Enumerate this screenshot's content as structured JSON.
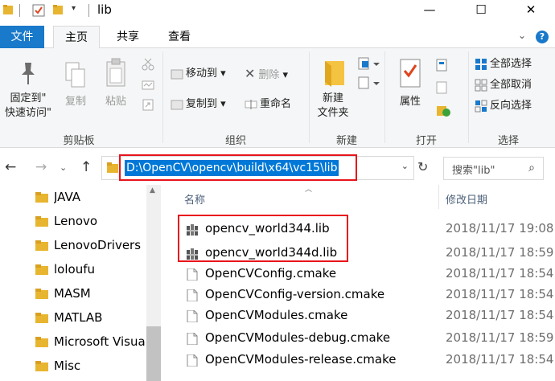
{
  "window": {
    "title": "lib",
    "minimize": "—",
    "maximize": "☐",
    "close": "✕"
  },
  "ribbon_tabs": [
    "文件",
    "主页",
    "共享",
    "查看"
  ],
  "ribbon": {
    "clipboard": {
      "pin_label_1": "固定到\"",
      "pin_label_2": "快速访问\"",
      "copy": "复制",
      "paste": "粘贴",
      "group": "剪贴板"
    },
    "organize": {
      "move_to": "移动到",
      "copy_to": "复制到",
      "delete": "删除",
      "rename": "重命名",
      "group": "组织"
    },
    "new": {
      "new_folder_1": "新建",
      "new_folder_2": "文件夹",
      "group": "新建"
    },
    "open": {
      "properties": "属性",
      "group": "打开"
    },
    "select": {
      "select_all": "全部选择",
      "select_none": "全部取消",
      "invert": "反向选择",
      "group": "选择"
    }
  },
  "address": {
    "path": "D:\\OpenCV\\opencv\\build\\x64\\vc15\\lib",
    "search_placeholder": "搜索\"lib\""
  },
  "nav_items": [
    "JAVA",
    "Lenovo",
    "LenovoDrivers",
    "loloufu",
    "MASM",
    "MATLAB",
    "Microsoft Visual",
    "Misc"
  ],
  "columns": {
    "name": "名称",
    "date": "修改日期"
  },
  "files": [
    {
      "name": "opencv_world344.lib",
      "date": "2018/11/17 19:08",
      "type": "lib"
    },
    {
      "name": "opencv_world344d.lib",
      "date": "2018/11/17 18:59",
      "type": "lib"
    },
    {
      "name": "OpenCVConfig.cmake",
      "date": "2018/11/17 18:54",
      "type": "cmake"
    },
    {
      "name": "OpenCVConfig-version.cmake",
      "date": "2018/11/17 18:54",
      "type": "cmake"
    },
    {
      "name": "OpenCVModules.cmake",
      "date": "2018/11/17 18:54",
      "type": "cmake"
    },
    {
      "name": "OpenCVModules-debug.cmake",
      "date": "2018/11/17 18:59",
      "type": "cmake"
    },
    {
      "name": "OpenCVModules-release.cmake",
      "date": "2018/11/17 18:54",
      "type": "cmake"
    }
  ],
  "colors": {
    "accent": "#1979ca",
    "selection": "#0078d7",
    "highlight_box": "#e8141c",
    "folder": "#e8b530"
  }
}
